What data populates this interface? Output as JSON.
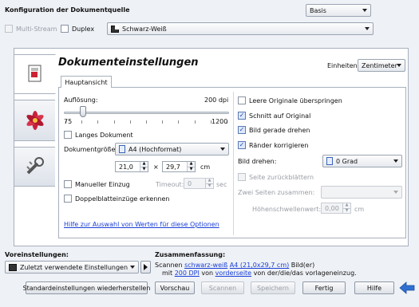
{
  "source": {
    "title": "Konfiguration der Dokumentquelle",
    "mode": "Basis",
    "multistream": "Multi-Stream",
    "duplex": "Duplex",
    "color_mode": "Schwarz-Weiß"
  },
  "doc": {
    "title": "Dokumenteinstellungen",
    "units_label": "Einheiten:",
    "units_value": "Zentimeter",
    "tab": "Hauptansicht",
    "resolution_label": "Auflösung:",
    "resolution_value": "200 dpi",
    "slider_min": "75",
    "slider_max": "1200",
    "slider_fraction": 0.1,
    "long_doc": "Langes Dokument",
    "size_label": "Dokumentgröße:",
    "size_value": "A4 (Hochformat)",
    "width": "21,0",
    "times": "×",
    "height": "29,7",
    "cm": "cm",
    "manual_feed": "Manueller Einzug",
    "timeout_label": "Timeout:",
    "timeout_value": "0",
    "sec": "sec",
    "double_feed": "Doppelblatteinzüge erkennen",
    "help_link": "Hilfe zur Auswahl von Werten für diese Optionen",
    "skip_blank": "Leere Originale überspringen",
    "crop": "Schnitt auf Original",
    "deskew": "Bild gerade drehen",
    "edges": "Ränder korrigieren",
    "rotate_label": "Bild drehen:",
    "rotate_value": "0 Grad",
    "scroll_page": "Seite zurückblättern",
    "merge_label": "Zwei Seiten zusammen:",
    "height_threshold_label": "Höhenschwellenwert:",
    "height_threshold_value": "0,00",
    "cm2": "cm"
  },
  "presets": {
    "label": "Voreinstellungen:",
    "value": "Zuletzt verwendete Einstellungen"
  },
  "summary": {
    "label": "Zusammenfassung:",
    "line1": {
      "t1": "Scannen ",
      "link1": "schwarz-weiß",
      "t2": " ",
      "link2": "A4 (21,0x29,7 cm)",
      "t3": " Bild(er)"
    },
    "line2": {
      "t1": "mit ",
      "link1": "200 DPI",
      "t2": " von ",
      "link2": "vorderseite",
      "t3": " von der/die/das vorlageneinzug."
    }
  },
  "buttons": {
    "defaults": "Standardeinstellungen wiederherstellen",
    "preview": "Vorschau",
    "scan": "Scannen",
    "save": "Speichern",
    "done": "Fertig",
    "help": "Hilfe"
  },
  "checked": {
    "multistream": false,
    "duplex": false,
    "long_doc": false,
    "manual_feed": false,
    "double_feed": false,
    "skip_blank": false,
    "crop": true,
    "deskew": true,
    "edges": true,
    "scroll_page": false
  }
}
